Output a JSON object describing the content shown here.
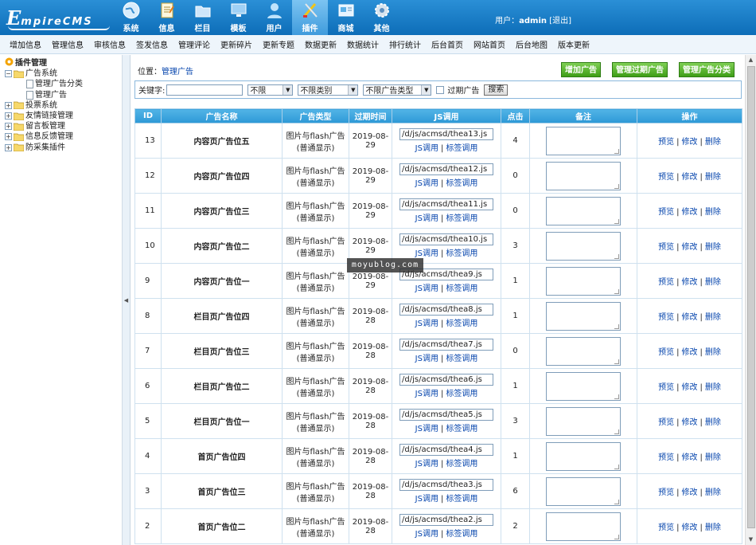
{
  "logo": {
    "big": "E",
    "small": "mpireCMS"
  },
  "topnav": [
    {
      "label": "系统",
      "icon": "globe-icon"
    },
    {
      "label": "信息",
      "icon": "document-icon"
    },
    {
      "label": "栏目",
      "icon": "folder-icon"
    },
    {
      "label": "模板",
      "icon": "monitor-icon"
    },
    {
      "label": "用户",
      "icon": "user-icon"
    },
    {
      "label": "插件",
      "icon": "tools-icon"
    },
    {
      "label": "商城",
      "icon": "card-icon"
    },
    {
      "label": "其他",
      "icon": "gear-icon"
    }
  ],
  "user": {
    "prefix": "用户：",
    "name": "admin",
    "logout": "[退出]"
  },
  "menubar": [
    "增加信息",
    "管理信息",
    "审核信息",
    "签发信息",
    "管理评论",
    "更新碎片",
    "更新专题",
    "数据更新",
    "数据统计",
    "排行统计",
    "后台首页",
    "网站首页",
    "后台地图",
    "版本更新"
  ],
  "tree": {
    "root": "插件管理",
    "groups": [
      {
        "label": "广告系统",
        "expanded": true,
        "children": [
          "管理广告分类",
          "管理广告"
        ]
      },
      {
        "label": "投票系统"
      },
      {
        "label": "友情链接管理"
      },
      {
        "label": "留言板管理"
      },
      {
        "label": "信息反馈管理"
      },
      {
        "label": "防采集插件"
      }
    ]
  },
  "position": {
    "label": "位置：",
    "link": "管理广告"
  },
  "buttons": {
    "add": "增加广告",
    "expired": "管理过期广告",
    "category": "管理广告分类"
  },
  "search": {
    "keyword_label": "关键字:",
    "select1": "不限",
    "select2": "不限类别",
    "select3": "不限广告类型",
    "expired_label": "过期广告",
    "submit": "搜索"
  },
  "table": {
    "headers": [
      "ID",
      "广告名称",
      "广告类型",
      "过期时间",
      "JS调用",
      "点击",
      "备注",
      "操作"
    ],
    "type_text": [
      "图片与flash广告",
      "(普通显示)"
    ],
    "js_link": "JS调用",
    "tag_link": "标签调用",
    "sep": "|",
    "ops": [
      "预览",
      "修改",
      "删除"
    ],
    "rows": [
      {
        "id": "13",
        "name": "内容页广告位五",
        "date": [
          "2019-08-",
          "29"
        ],
        "js": "/d/js/acmsd/thea13.js",
        "clicks": "4"
      },
      {
        "id": "12",
        "name": "内容页广告位四",
        "date": [
          "2019-08-",
          "29"
        ],
        "js": "/d/js/acmsd/thea12.js",
        "clicks": "0"
      },
      {
        "id": "11",
        "name": "内容页广告位三",
        "date": [
          "2019-08-",
          "29"
        ],
        "js": "/d/js/acmsd/thea11.js",
        "clicks": "0"
      },
      {
        "id": "10",
        "name": "内容页广告位二",
        "date": [
          "2019-08-",
          "29"
        ],
        "js": "/d/js/acmsd/thea10.js",
        "clicks": "3"
      },
      {
        "id": "9",
        "name": "内容页广告位一",
        "date": [
          "2019-08-",
          "29"
        ],
        "js": "/d/js/acmsd/thea9.js",
        "clicks": "1"
      },
      {
        "id": "8",
        "name": "栏目页广告位四",
        "date": [
          "2019-08-",
          "28"
        ],
        "js": "/d/js/acmsd/thea8.js",
        "clicks": "1"
      },
      {
        "id": "7",
        "name": "栏目页广告位三",
        "date": [
          "2019-08-",
          "28"
        ],
        "js": "/d/js/acmsd/thea7.js",
        "clicks": "0"
      },
      {
        "id": "6",
        "name": "栏目页广告位二",
        "date": [
          "2019-08-",
          "28"
        ],
        "js": "/d/js/acmsd/thea6.js",
        "clicks": "1"
      },
      {
        "id": "5",
        "name": "栏目页广告位一",
        "date": [
          "2019-08-",
          "28"
        ],
        "js": "/d/js/acmsd/thea5.js",
        "clicks": "3"
      },
      {
        "id": "4",
        "name": "首页广告位四",
        "date": [
          "2019-08-",
          "28"
        ],
        "js": "/d/js/acmsd/thea4.js",
        "clicks": "1"
      },
      {
        "id": "3",
        "name": "首页广告位三",
        "date": [
          "2019-08-",
          "28"
        ],
        "js": "/d/js/acmsd/thea3.js",
        "clicks": "6"
      },
      {
        "id": "2",
        "name": "首页广告位二",
        "date": [
          "2019-08-",
          "28"
        ],
        "js": "/d/js/acmsd/thea2.js",
        "clicks": "2"
      }
    ]
  },
  "watermark": "moyublog.com"
}
